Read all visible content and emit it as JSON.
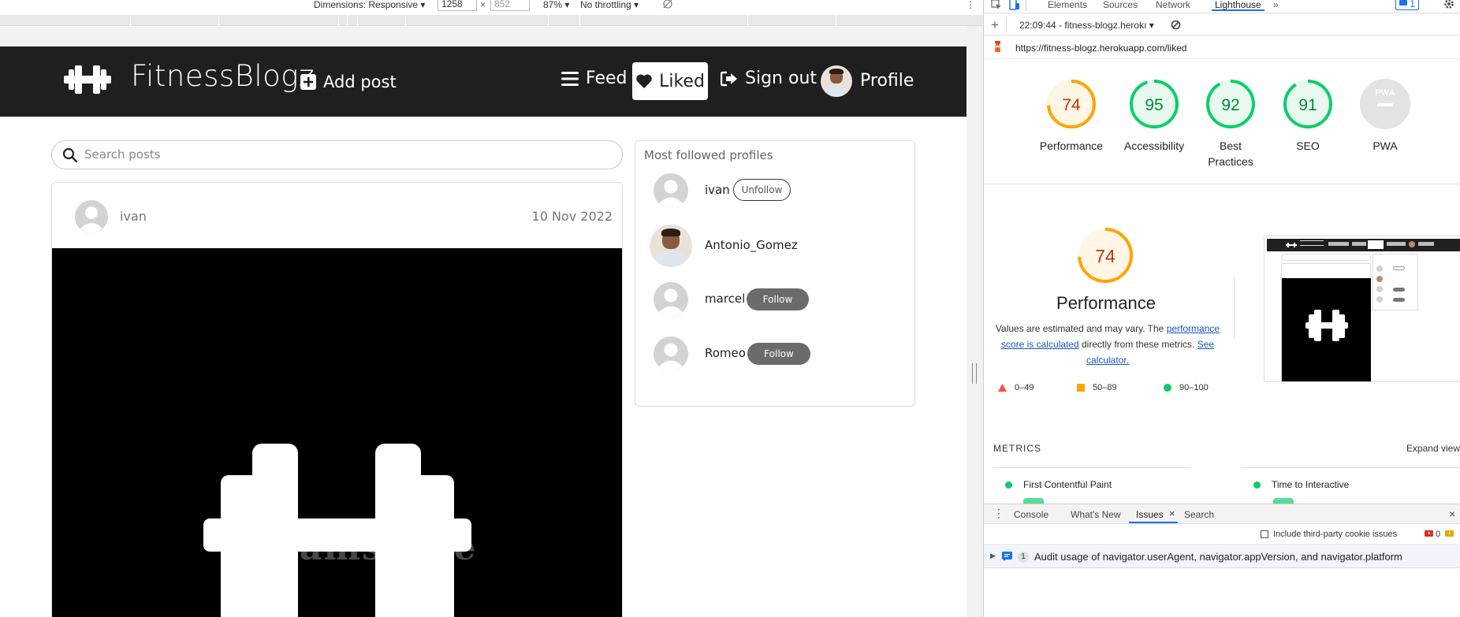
{
  "devtools_toolbar": {
    "dimensions_label": "Dimensions: Responsive",
    "width_value": "1258",
    "height_value": "852",
    "zoom": "87%",
    "throttling": "No throttling",
    "times_glyph": "×"
  },
  "site": {
    "brand": "FitnessBlogz",
    "nav": {
      "add_post": "Add post",
      "feed": "Feed",
      "liked": "Liked",
      "sign_out": "Sign out",
      "profile": "Profile"
    },
    "search": {
      "placeholder": "Search posts"
    },
    "post": {
      "author": "ivan",
      "date": "10 Nov 2022",
      "watermark": "dreamstime"
    },
    "sidebar": {
      "title": "Most followed profiles",
      "profiles": [
        {
          "name": "ivan",
          "action": "Unfollow"
        },
        {
          "name": "Antonio_Gomez",
          "action": ""
        },
        {
          "name": "marcel",
          "action": "Follow"
        },
        {
          "name": "Romeo",
          "action": "Follow"
        }
      ]
    }
  },
  "devtools": {
    "tabs": [
      "Elements",
      "Sources",
      "Network",
      "Lighthouse"
    ],
    "active_tab": "Lighthouse",
    "tabs_more": "»",
    "issue_count": "1",
    "run_label": "22:09:44 - fitness-blogz.herokı",
    "url": "https://fitness-blogz.herokuapp.com/liked",
    "scores": [
      {
        "label": "Performance",
        "value": "74",
        "color": "#ffa400"
      },
      {
        "label": "Accessibility",
        "value": "95",
        "color": "#0cce6b"
      },
      {
        "label": "Best Practices",
        "value": "92",
        "color": "#0cce6b"
      },
      {
        "label": "SEO",
        "value": "91",
        "color": "#0cce6b"
      },
      {
        "label": "PWA",
        "value": "PWA",
        "color": "#cccccc"
      }
    ],
    "performance": {
      "score": "74",
      "title": "Performance",
      "desc_before": "Values are estimated and may vary. The",
      "desc_link1": "performance score is calculated",
      "desc_middle": "directly from these metrics.",
      "desc_link2": "See calculator.",
      "legend": [
        {
          "range": "0–49",
          "color": "#ff4e42"
        },
        {
          "range": "50–89",
          "color": "#ffa400"
        },
        {
          "range": "90–100",
          "color": "#0cce6b"
        }
      ]
    },
    "metrics": {
      "heading": "METRICS",
      "expand": "Expand view",
      "items": [
        "First Contentful Paint",
        "Time to Interactive"
      ]
    },
    "drawer": {
      "tabs": [
        "Console",
        "What's New",
        "Issues",
        "Search"
      ],
      "active_tab": "Issues",
      "checkbox_label": "Include third-party cookie issues",
      "error_count": "0",
      "issue_badge": "1",
      "issue_text": "Audit usage of navigator.userAgent, navigator.appVersion, and navigator.platform"
    }
  }
}
